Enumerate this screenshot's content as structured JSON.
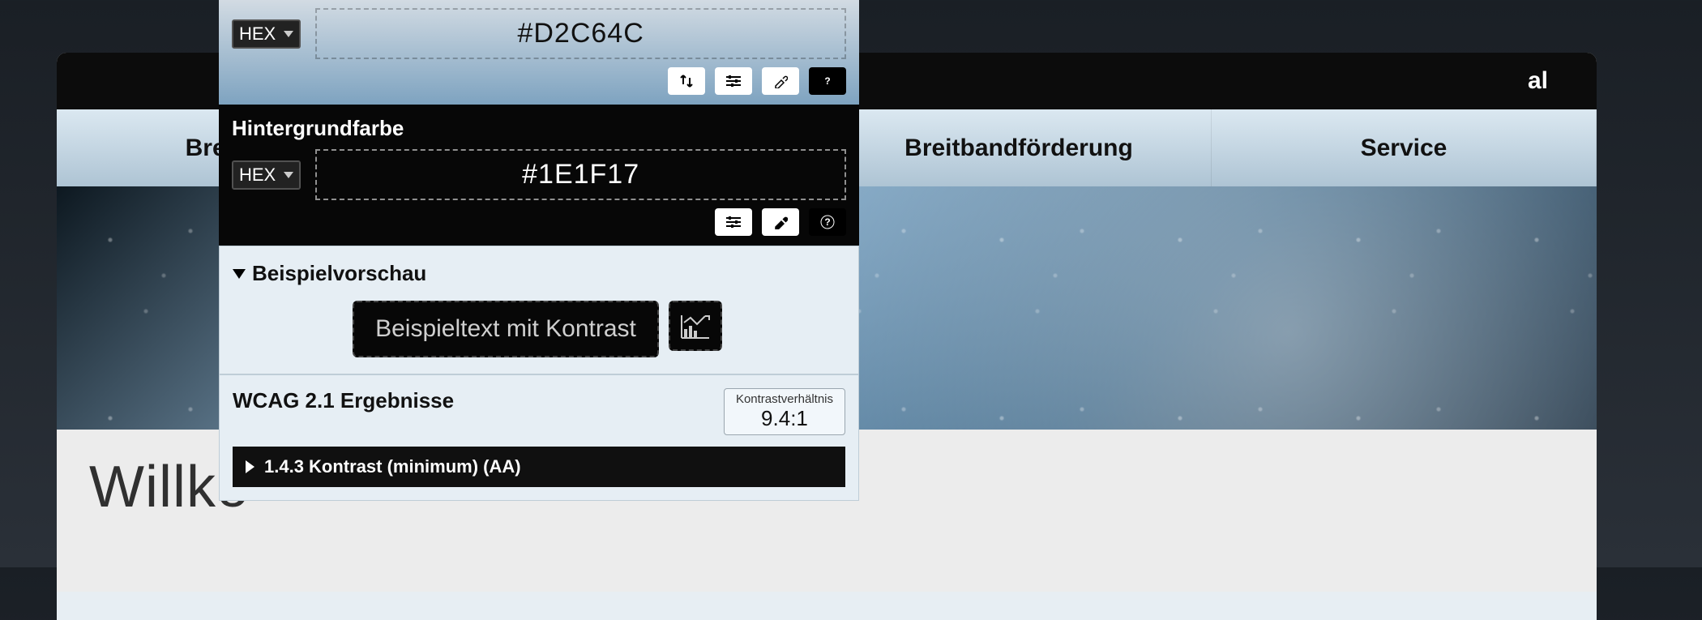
{
  "site": {
    "header_suffix": "al",
    "nav": {
      "item1": "Breitbanda",
      "item2": "Breitbandförderung",
      "item3": "Service"
    },
    "welcome": "Willko"
  },
  "tool": {
    "foreground": {
      "format": "HEX",
      "value": "#D2C64C"
    },
    "background": {
      "label": "Hintergrundfarbe",
      "format": "HEX",
      "value": "#1E1F17"
    },
    "preview": {
      "header": "Beispielvorschau",
      "sample_text": "Beispieltext mit Kontrast"
    },
    "results": {
      "title": "WCAG 2.1 Ergebnisse",
      "ratio_label": "Kontrastverhältnis",
      "ratio_value": "9.4:1",
      "criterion": "1.4.3 Kontrast (minimum) (AA)"
    }
  }
}
